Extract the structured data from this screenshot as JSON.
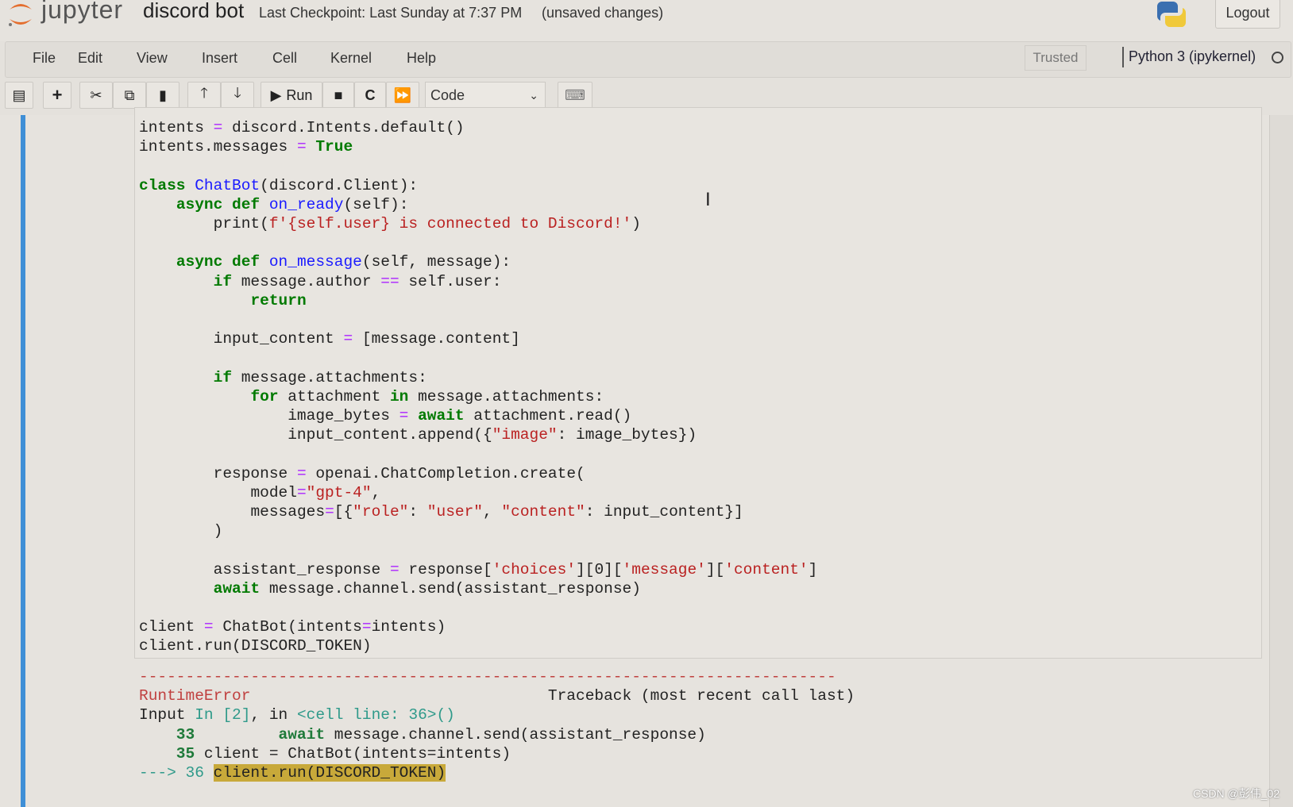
{
  "header": {
    "logo_text": "jupyter",
    "notebook_title": "discord bot",
    "checkpoint": "Last Checkpoint: Last Sunday at 7:37 PM",
    "unsaved": "(unsaved changes)",
    "logout": "Logout"
  },
  "menu": {
    "items": [
      "File",
      "Edit",
      "View",
      "Insert",
      "Cell",
      "Kernel",
      "Help"
    ],
    "trusted": "Trusted",
    "kernel": "Python 3 (ipykernel)"
  },
  "toolbar": {
    "run_label": "Run",
    "cell_type": "Code",
    "icons": [
      "save-icon",
      "plus-icon",
      "cut-icon",
      "copy-icon",
      "paste-icon",
      "arrow-up-icon",
      "arrow-down-icon",
      "run-icon",
      "stop-icon",
      "restart-icon",
      "fast-forward-icon",
      "keyboard-icon"
    ]
  },
  "code_lines": [
    "intents = discord.Intents.default()",
    "intents.messages = True",
    "",
    "class ChatBot(discord.Client):",
    "    async def on_ready(self):",
    "        print(f'{self.user} is connected to Discord!')",
    "",
    "    async def on_message(self, message):",
    "        if message.author == self.user:",
    "            return",
    "",
    "        input_content = [message.content]",
    "",
    "        if message.attachments:",
    "            for attachment in message.attachments:",
    "                image_bytes = await attachment.read()",
    "                input_content.append({\"image\": image_bytes})",
    "",
    "        response = openai.ChatCompletion.create(",
    "            model=\"gpt-4\",",
    "            messages=[{\"role\": \"user\", \"content\": input_content}]",
    "        )",
    "",
    "        assistant_response = response['choices'][0]['message']['content']",
    "        await message.channel.send(assistant_response)",
    "",
    "client = ChatBot(intents=intents)",
    "client.run(DISCORD_TOKEN)"
  ],
  "traceback": [
    [
      [
        "---------------------------------------------------------------------------",
        "e"
      ]
    ],
    [
      [
        "RuntimeError",
        "e"
      ],
      [
        "                                Traceback (most recent call last)",
        ""
      ]
    ],
    [
      [
        "Input ",
        ""
      ],
      [
        "In [2]",
        "n2"
      ],
      [
        ", in ",
        ""
      ],
      [
        "<cell line: 36>()",
        "c"
      ]
    ],
    [
      [
        "    33",
        "n"
      ],
      [
        "         ",
        ""
      ],
      [
        "await",
        "n"
      ],
      [
        " message.channel.send(assistant_response)",
        ""
      ]
    ],
    [
      [
        "    35",
        "n"
      ],
      [
        " client = ChatBot(intents=intents)",
        ""
      ]
    ],
    [
      [
        "---> 36",
        "n2"
      ],
      [
        " ",
        ""
      ],
      [
        "client.run(DISCORD_TOKEN)",
        "hl"
      ]
    ]
  ],
  "watermark": "CSDN @彭伟_02",
  "colors": {
    "cell_bar": "#3f8fd6",
    "keyword": "#007a00",
    "string": "#ba2121",
    "error": "#c0403f"
  }
}
